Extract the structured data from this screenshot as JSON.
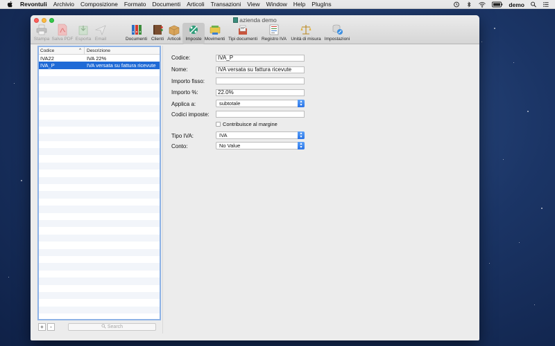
{
  "menubar": {
    "app_name": "Revontuli",
    "items": [
      "Archivio",
      "Composizione",
      "Formato",
      "Documenti",
      "Articoli",
      "Transazioni",
      "View",
      "Window",
      "Help",
      "PlugIns"
    ],
    "user": "demo",
    "icons": [
      "apple-icon",
      "time-machine-icon",
      "bluetooth-icon",
      "wifi-icon",
      "battery-icon",
      "spotlight-icon",
      "notification-center-icon"
    ]
  },
  "window": {
    "title": "azienda demo"
  },
  "toolbar": {
    "items": [
      {
        "label": "Stampa",
        "icon": "printer-icon",
        "disabled": true
      },
      {
        "label": "Salva PDF",
        "icon": "pdf-icon",
        "disabled": true
      },
      {
        "label": "Esporta",
        "icon": "export-icon",
        "disabled": true
      },
      {
        "label": "Email",
        "icon": "email-icon",
        "disabled": true
      },
      {
        "label": "Documenti",
        "icon": "binders-icon",
        "disabled": false
      },
      {
        "label": "Clienti",
        "icon": "address-book-icon",
        "disabled": false
      },
      {
        "label": "Articoli",
        "icon": "box-icon",
        "disabled": false
      },
      {
        "label": "Imposte",
        "icon": "taxes-icon",
        "disabled": false,
        "selected": true
      },
      {
        "label": "Movimenti",
        "icon": "movements-icon",
        "disabled": false
      },
      {
        "label": "Tipi documenti",
        "icon": "document-types-icon",
        "disabled": false
      },
      {
        "label": "Registro IVA",
        "icon": "register-icon",
        "disabled": false
      },
      {
        "label": "Unità di misura",
        "icon": "scale-icon",
        "disabled": false
      },
      {
        "label": "Impostazioni",
        "icon": "settings-icon",
        "disabled": false
      }
    ]
  },
  "list": {
    "columns": [
      "Codice",
      "Descrizione"
    ],
    "rows": [
      {
        "codice": "IVA22",
        "descrizione": "IVA 22%",
        "selected": false
      },
      {
        "codice": "IVA_P",
        "descrizione": "IVA versata su fattura ricevute",
        "selected": true
      }
    ],
    "add_label": "+",
    "remove_label": "-",
    "search_placeholder": "Search"
  },
  "form": {
    "codice_label": "Codice:",
    "codice_value": "IVA_P",
    "nome_label": "Nome:",
    "nome_value": "IVA versata su fattura ricevute",
    "importo_fisso_label": "Importo fisso:",
    "importo_fisso_value": "",
    "importo_pct_label": "Importo %:",
    "importo_pct_value": "22.0%",
    "applica_label": "Applica a:",
    "applica_value": "subtotale",
    "codici_imposte_label": "Codici imposte:",
    "codici_imposte_value": "",
    "contribuisce_label": "Contribuisce al margine",
    "tipo_iva_label": "Tipo IVA:",
    "tipo_iva_value": "IVA",
    "conto_label": "Conto:",
    "conto_value": "No Value"
  },
  "colors": {
    "selection": "#1f6ad6",
    "list_focus_border": "#8db2e6",
    "desktop": "#1b3566"
  }
}
